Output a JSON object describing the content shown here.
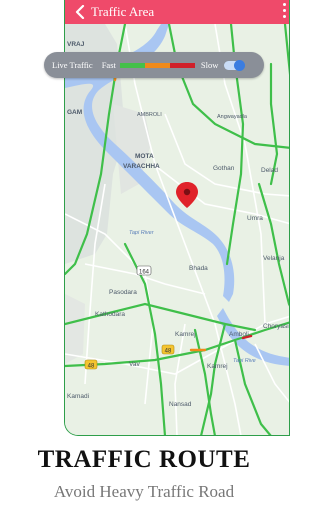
{
  "app_bar": {
    "title": "Traffic Area",
    "color": "#ef4a6a"
  },
  "legend": {
    "title": "Live Traffic",
    "fast_label": "Fast",
    "slow_label": "Slow",
    "colors": [
      "#44c04a",
      "#f08a1a",
      "#d0202a"
    ],
    "toggle_on": true
  },
  "map": {
    "labels": {
      "vraj": "VRAJ",
      "ambroli": "AMBROLI",
      "angwayadla": "Angwayadla",
      "gothan": "Gothan",
      "delad": "Delad",
      "mota": "MOTA",
      "varachha": "VARACHHA",
      "gam": "GAM",
      "umra": "Umra",
      "velanja": "Velanja",
      "tapi_river": "Tapi River",
      "bhada": "Bhada",
      "pasodara": "Pasodara",
      "kathodara": "Kathodara",
      "kamrej": "Kamrej",
      "amboli": "Amboli",
      "choryasi": "Choryasi",
      "vav": "Vav",
      "kamrej2": "Kamrej",
      "nansad": "Nansad",
      "kamadi": "Kamadi",
      "tapi_right": "Tapi Rive",
      "road_48": "48",
      "road_164": "164",
      "road_48b": "48"
    }
  },
  "promo": {
    "headline": "TRAFFIC ROUTE",
    "subline": "Avoid Heavy Traffic Road"
  }
}
